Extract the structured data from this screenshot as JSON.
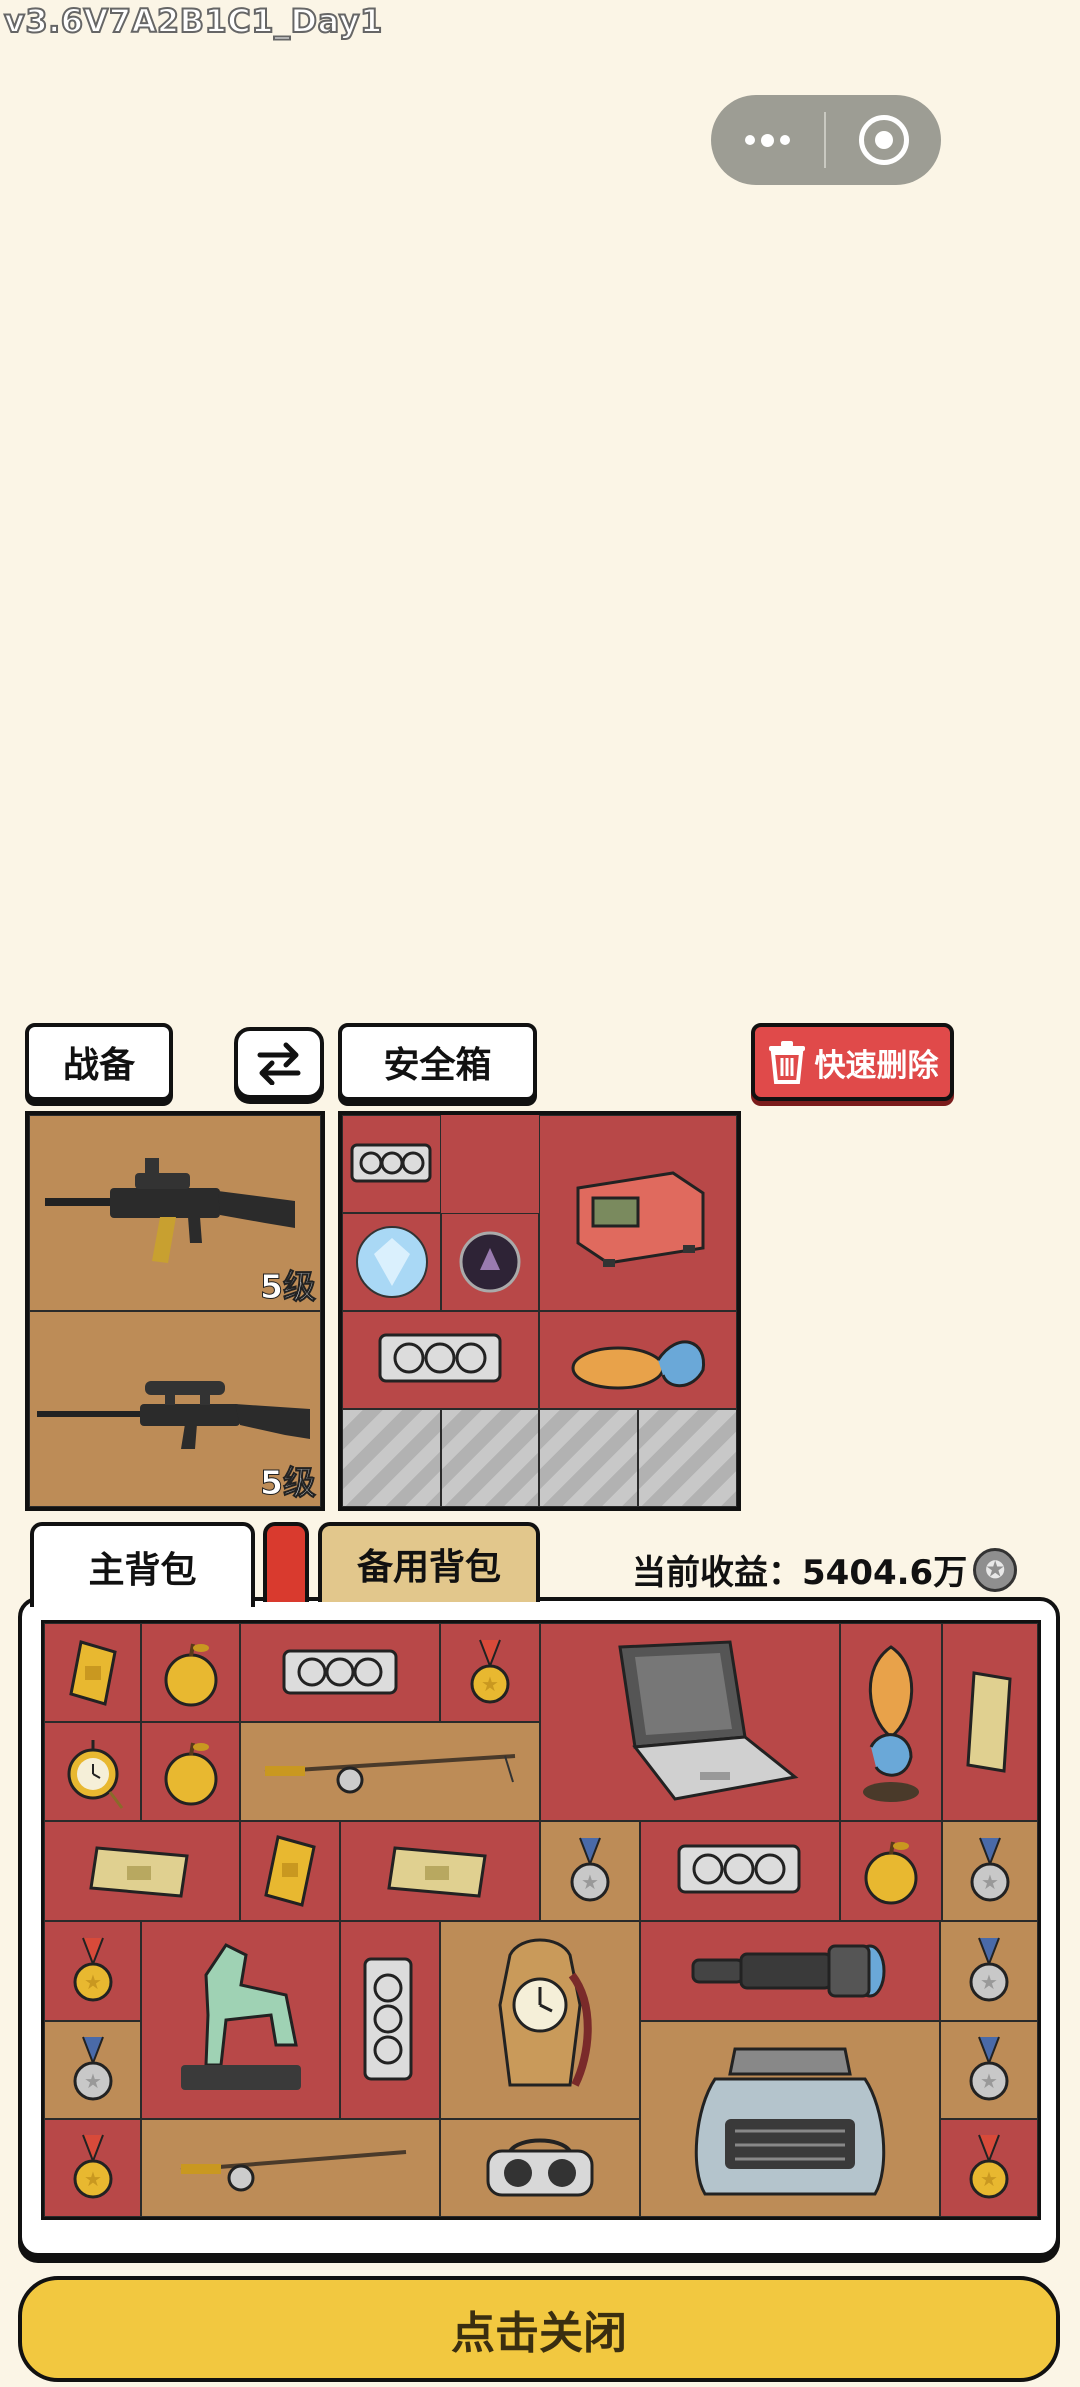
{
  "version_label": "v3.6V7A2B1C1_Day1",
  "capsule": {
    "menu_icon": "more-dots-icon",
    "close_icon": "target-circle-icon"
  },
  "toolbar": {
    "gear_tab": "战备",
    "swap_icon": "swap-arrows-icon",
    "safe_tab": "安全箱",
    "quick_delete": "快速删除"
  },
  "loadout": {
    "items": [
      {
        "name": "assault rifle",
        "level": "5级"
      },
      {
        "name": "sniper rifle",
        "level": "5级"
      }
    ]
  },
  "safe_box": {
    "items": [
      "graphics card",
      "red server box",
      "diamond",
      "gem orb",
      "graphics card",
      "koi fish statue"
    ],
    "empty_locked_slots": 4
  },
  "bag_tabs": {
    "main": "主背包",
    "backup": "备用背包"
  },
  "income": {
    "label": "当前收益：",
    "value": "5404.6万",
    "coin_icon": "silver-coin-icon"
  },
  "main_bag": {
    "items": [
      "gold bar",
      "golden apple",
      "graphics card",
      "gold medal",
      "laptop",
      "koi fish statue",
      "gold bar",
      "pocket watch",
      "golden apple",
      "fishing rod",
      "gold bar",
      "gold bar",
      "gold bar",
      "silver medal",
      "graphics card",
      "golden apple",
      "silver medal",
      "gold medal",
      "jade horse statue",
      "graphics card",
      "antique clock",
      "telescope",
      "silver medal",
      "silver medal",
      "typewriter",
      "silver medal",
      "gold medal",
      "fishing rod",
      "vr headset",
      "gold medal"
    ]
  },
  "close_button": "点击关闭",
  "colors": {
    "background": "#fbf5e6",
    "red_cell": "#b84848",
    "tan_cell": "#bd8c57",
    "delete": "#e04a4a",
    "close_button": "#f2c840"
  }
}
